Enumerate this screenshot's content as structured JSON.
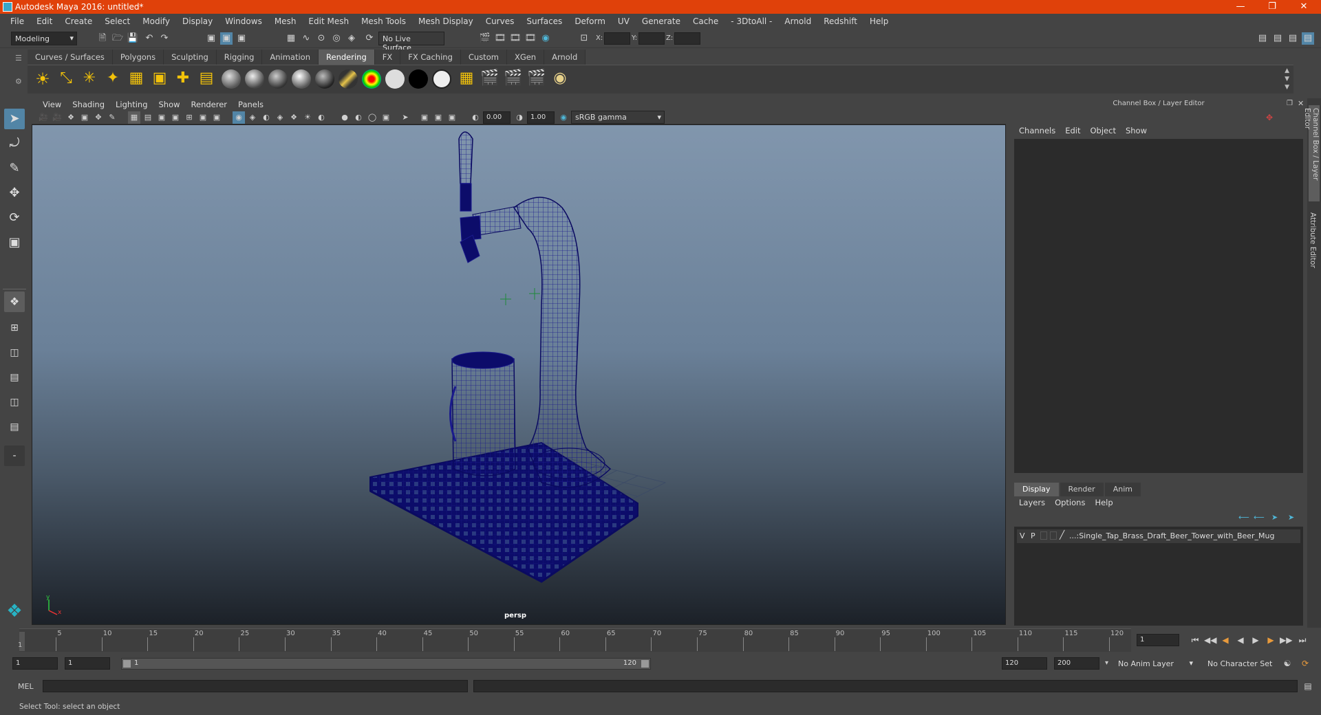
{
  "window": {
    "title": "Autodesk Maya 2016: untitled*",
    "min_icon": "minimize-icon",
    "max_icon": "restore-icon",
    "close_icon": "close-icon"
  },
  "menubar": [
    "File",
    "Edit",
    "Create",
    "Select",
    "Modify",
    "Display",
    "Windows",
    "Mesh",
    "Edit Mesh",
    "Mesh Tools",
    "Mesh Display",
    "Curves",
    "Surfaces",
    "Deform",
    "UV",
    "Generate",
    "Cache",
    "- 3DtoAll -",
    "Arnold",
    "Redshift",
    "Help"
  ],
  "statusline": {
    "mode": "Modeling",
    "live_surface": "No Live Surface",
    "x_label": "X:",
    "y_label": "Y:",
    "z_label": "Z:"
  },
  "shelf_tabs": [
    "Curves / Surfaces",
    "Polygons",
    "Sculpting",
    "Rigging",
    "Animation",
    "Rendering",
    "FX",
    "FX Caching",
    "Custom",
    "XGen",
    "Arnold"
  ],
  "shelf_active": "Rendering",
  "viewport": {
    "menu": [
      "View",
      "Shading",
      "Lighting",
      "Show",
      "Renderer",
      "Panels"
    ],
    "exposure": "0.00",
    "gamma": "1.00",
    "colorspace": "sRGB gamma",
    "camera": "persp",
    "axis_y": "y",
    "axis_x": "x"
  },
  "channel_box": {
    "header": "Channel Box / Layer Editor",
    "menu": [
      "Channels",
      "Edit",
      "Object",
      "Show"
    ]
  },
  "layer_editor": {
    "tabs": [
      "Display",
      "Render",
      "Anim"
    ],
    "active_tab": "Display",
    "menu": [
      "Layers",
      "Options",
      "Help"
    ],
    "layer": {
      "v": "V",
      "p": "P",
      "name": "...:Single_Tap_Brass_Draft_Beer_Tower_with_Beer_Mug"
    }
  },
  "side_tabs": [
    "Channel Box / Layer Editor",
    "Attribute Editor"
  ],
  "timeline": {
    "ticks": [
      "5",
      "10",
      "15",
      "20",
      "25",
      "30",
      "35",
      "40",
      "45",
      "50",
      "55",
      "60",
      "65",
      "70",
      "75",
      "80",
      "85",
      "90",
      "95",
      "100",
      "105",
      "110",
      "115",
      "120"
    ],
    "start_marker": "1",
    "current_frame": "1"
  },
  "range": {
    "start": "1",
    "anim_start": "1",
    "range_start": "1",
    "range_end": "120",
    "end": "120",
    "anim_end": "200",
    "anim_layer": "No Anim Layer",
    "char_set": "No Character Set"
  },
  "cmdline": {
    "label": "MEL"
  },
  "helpline": {
    "text": "Select Tool: select an object"
  },
  "colors": {
    "titlebar": "#e0410a",
    "accent": "#5285a6",
    "wire": "#1a1a8c"
  }
}
